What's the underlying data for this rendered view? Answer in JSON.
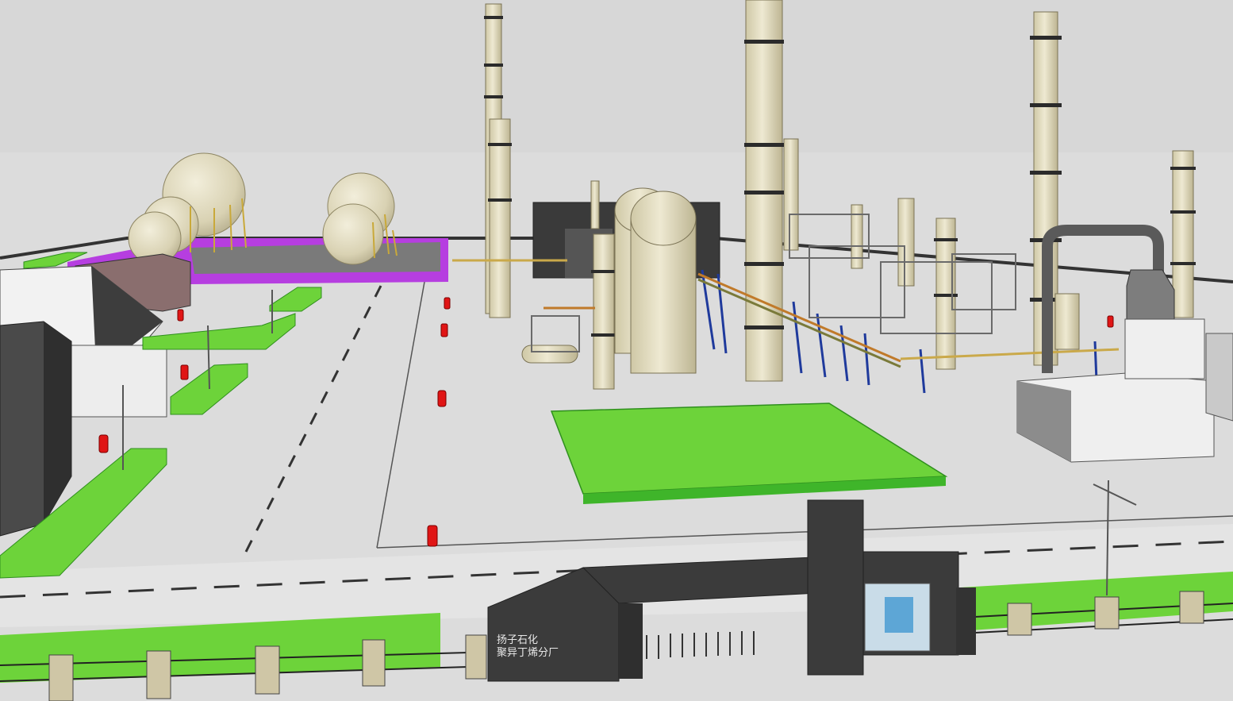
{
  "scene": {
    "description_type": "3D industrial plant model render",
    "gate_sign": {
      "line1": "扬子石化",
      "line2": "聚异丁烯分厂"
    }
  },
  "colors": {
    "sky": "#d7d7d7",
    "ground": "#dedede",
    "grass": "#6dd33a",
    "grass_edge": "#3fb52a",
    "tank": "#e6e1c8",
    "tank_shade": "#cfc8a6",
    "pipe_blue": "#1f3a9c",
    "magenta": "#b63ee0",
    "dark": "#3a3a3a",
    "hydrant": "#e01515"
  }
}
